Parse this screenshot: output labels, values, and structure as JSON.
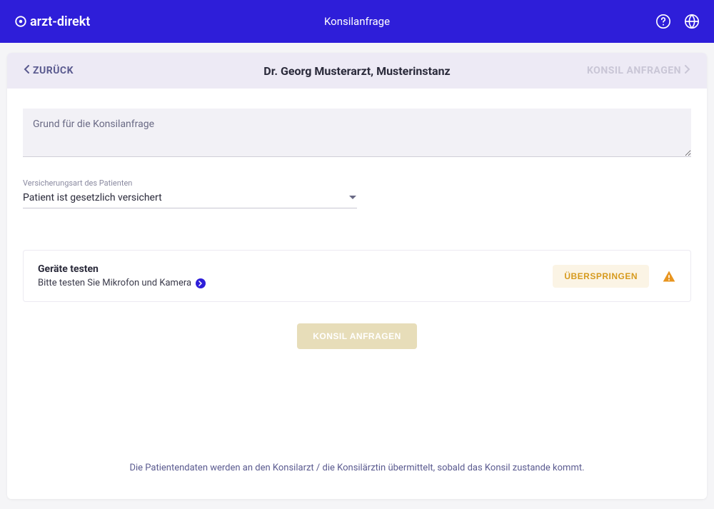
{
  "header": {
    "brand": "arzt-direkt",
    "title": "Konsilanfrage"
  },
  "card": {
    "back_label": "ZURÜCK",
    "title": "Dr. Georg Musterarzt, Musterinstanz",
    "forward_label": "KONSIL ANFRAGEN"
  },
  "form": {
    "reason_placeholder": "Grund für die Konsilanfrage",
    "reason_value": "",
    "insurance_label": "Versicherungsart des Patienten",
    "insurance_value": "Patient ist gesetzlich versichert"
  },
  "device_test": {
    "title": "Geräte testen",
    "subtitle": "Bitte testen Sie Mikrofon und Kamera",
    "skip_label": "ÜBERSPRINGEN"
  },
  "submit": {
    "label": "KONSIL ANFRAGEN"
  },
  "footer": {
    "note": "Die Patientendaten werden an den Konsilarzt / die Konsilärztin übermittelt, sobald das Konsil zustande kommt."
  }
}
